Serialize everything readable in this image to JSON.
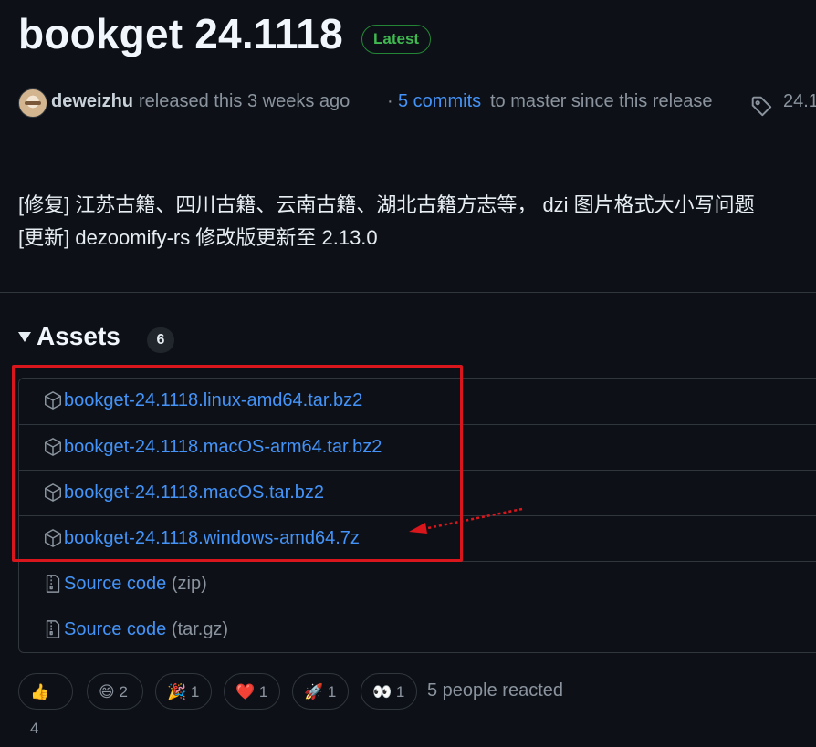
{
  "release": {
    "title": "bookget 24.1118",
    "latest_badge": "Latest",
    "author": "deweizhu",
    "released_text": "released this 3 weeks ago",
    "dot": "·",
    "commits_link": "5 commits",
    "commits_suffix": "to master since this release",
    "tag": "24.1"
  },
  "notes": [
    "[修复] 江苏古籍、四川古籍、云南古籍、湖北古籍方志等， dzi 图片格式大小写问题",
    "[更新] dezoomify-rs 修改版更新至 2.13.0"
  ],
  "assets": {
    "title": "Assets",
    "count": "6",
    "items": [
      {
        "name": "bookget-24.1118.linux-amd64.tar.bz2",
        "icon": "package-icon"
      },
      {
        "name": "bookget-24.1118.macOS-arm64.tar.bz2",
        "icon": "package-icon"
      },
      {
        "name": "bookget-24.1118.macOS.tar.bz2",
        "icon": "package-icon"
      },
      {
        "name": "bookget-24.1118.windows-amd64.7z",
        "icon": "package-icon"
      },
      {
        "name": "Source code",
        "suffix": "(zip)",
        "icon": "file-zip-icon"
      },
      {
        "name": "Source code",
        "suffix": "(tar.gz)",
        "icon": "file-zip-icon"
      }
    ]
  },
  "reactions": [
    {
      "emoji": "👍",
      "count": "4"
    },
    {
      "emoji": "😄",
      "count": "2"
    },
    {
      "emoji": "🎉",
      "count": "1"
    },
    {
      "emoji": "❤️",
      "count": "1"
    },
    {
      "emoji": "🚀",
      "count": "1"
    },
    {
      "emoji": "👀",
      "count": "1"
    }
  ],
  "reacted_text": "5 people reacted",
  "colors": {
    "background": "#0d1117",
    "link": "#4493f8",
    "muted": "#8b949e",
    "latest_green": "#3fb950",
    "annotation_red": "#d9161c"
  }
}
